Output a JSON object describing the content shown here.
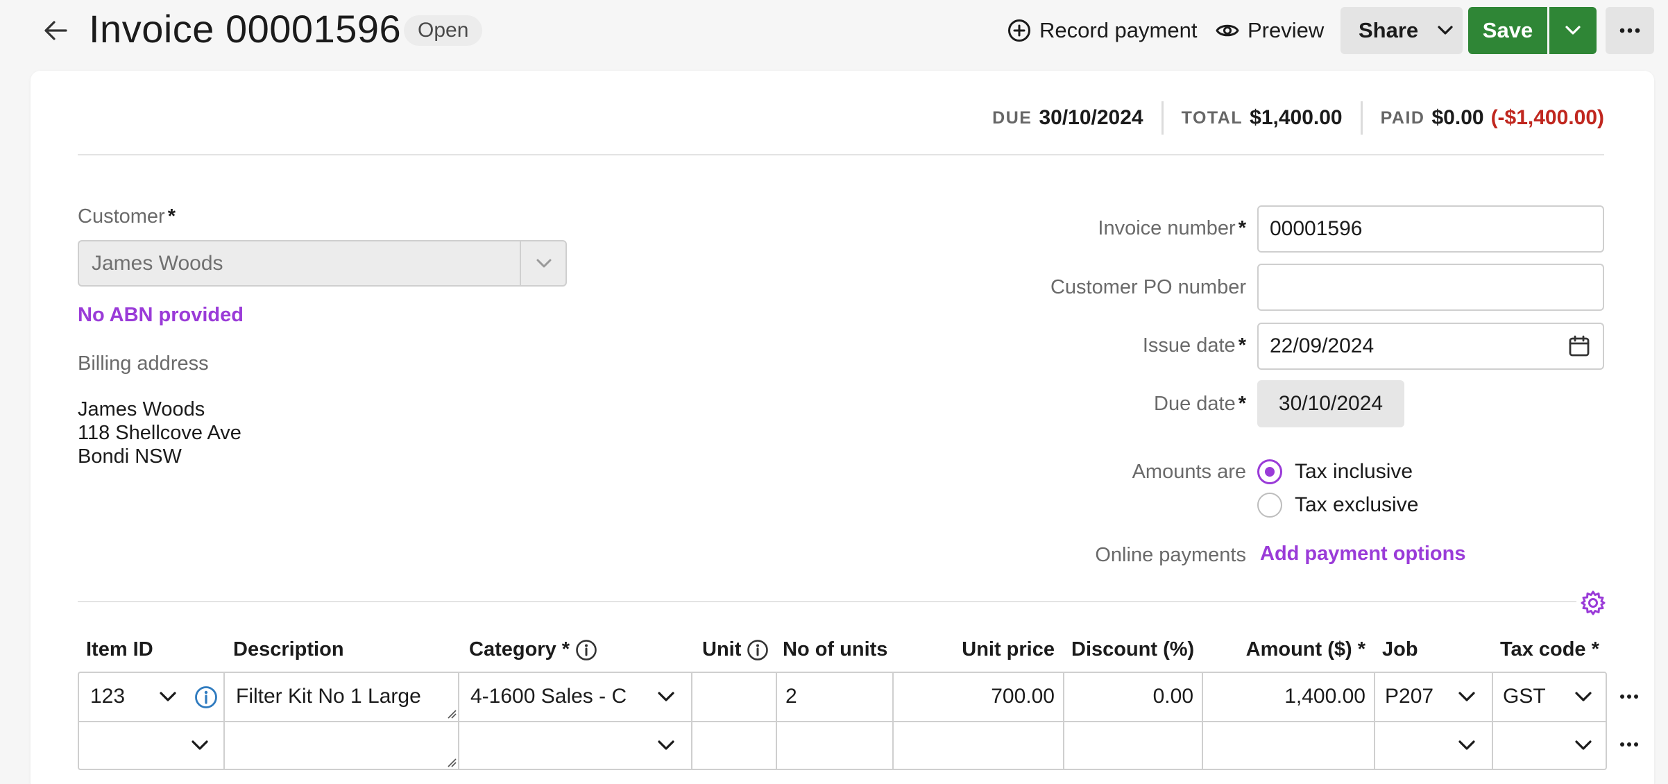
{
  "header": {
    "title": "Invoice 00001596",
    "status": "Open",
    "record_payment": "Record payment",
    "preview": "Preview",
    "share": "Share",
    "save": "Save"
  },
  "summary": {
    "due_label": "DUE",
    "due_value": "30/10/2024",
    "total_label": "TOTAL",
    "total_value": "$1,400.00",
    "paid_label": "PAID",
    "paid_value": "$0.00",
    "paid_balance": "(-$1,400.00)"
  },
  "customer": {
    "label": "Customer",
    "required": "*",
    "value": "James Woods",
    "no_abn": "No ABN provided",
    "billing_label": "Billing address",
    "address_line1": "James Woods",
    "address_line2": "118 Shellcove Ave",
    "address_line3": "Bondi NSW"
  },
  "details": {
    "invoice_number_label": "Invoice number",
    "invoice_number_value": "00001596",
    "po_label": "Customer PO number",
    "po_value": "",
    "issue_date_label": "Issue date",
    "issue_date_value": "22/09/2024",
    "due_date_label": "Due date",
    "due_date_value": "30/10/2024",
    "amounts_label": "Amounts are",
    "tax_inclusive": "Tax inclusive",
    "tax_exclusive": "Tax exclusive",
    "online_label": "Online payments",
    "add_payment": "Add payment options",
    "required": "*"
  },
  "table": {
    "headers": {
      "item_id": "Item ID",
      "description": "Description",
      "category": "Category *",
      "unit": "Unit",
      "no_units": "No of units",
      "unit_price": "Unit price",
      "discount": "Discount (%)",
      "amount": "Amount ($) *",
      "job": "Job",
      "tax_code": "Tax code *"
    },
    "rows": [
      {
        "item_id": "123",
        "description": "Filter Kit No 1 Large",
        "category": "4-1600  Sales - C",
        "unit": "",
        "no_units": "2",
        "unit_price": "700.00",
        "discount": "0.00",
        "amount": "1,400.00",
        "job": "P207",
        "tax_code": "GST"
      }
    ]
  },
  "colors": {
    "accent": "#9a3bd8",
    "save_green": "#2f8636",
    "negative": "#c0271f",
    "info_blue": "#2f7bbf"
  }
}
